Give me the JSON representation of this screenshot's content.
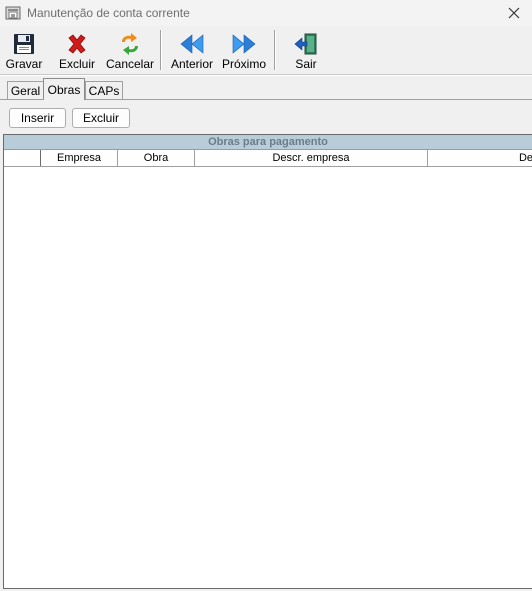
{
  "window": {
    "title": "Manutenção de conta corrente",
    "close_glyph": "✕"
  },
  "toolbar": {
    "gravar": "Gravar",
    "excluir": "Excluir",
    "cancelar": "Cancelar",
    "anterior": "Anterior",
    "proximo": "Próximo",
    "sair": "Sair"
  },
  "tabs": [
    {
      "label": "Geral",
      "active": false
    },
    {
      "label": "Obras",
      "active": true
    },
    {
      "label": "CAPs",
      "active": false
    }
  ],
  "actions": {
    "inserir": "Inserir",
    "excluir": "Excluir"
  },
  "grid": {
    "caption": "Obras para pagamento",
    "columns": [
      "Empresa",
      "Obra",
      "Descr. empresa",
      "De"
    ],
    "rows": []
  },
  "colors": {
    "caption_bg": "#b9cdd8",
    "caption_text": "#6a7e8a",
    "excluir_icon": "#d11a1a",
    "nav_arrows": "#2a7fd8"
  }
}
